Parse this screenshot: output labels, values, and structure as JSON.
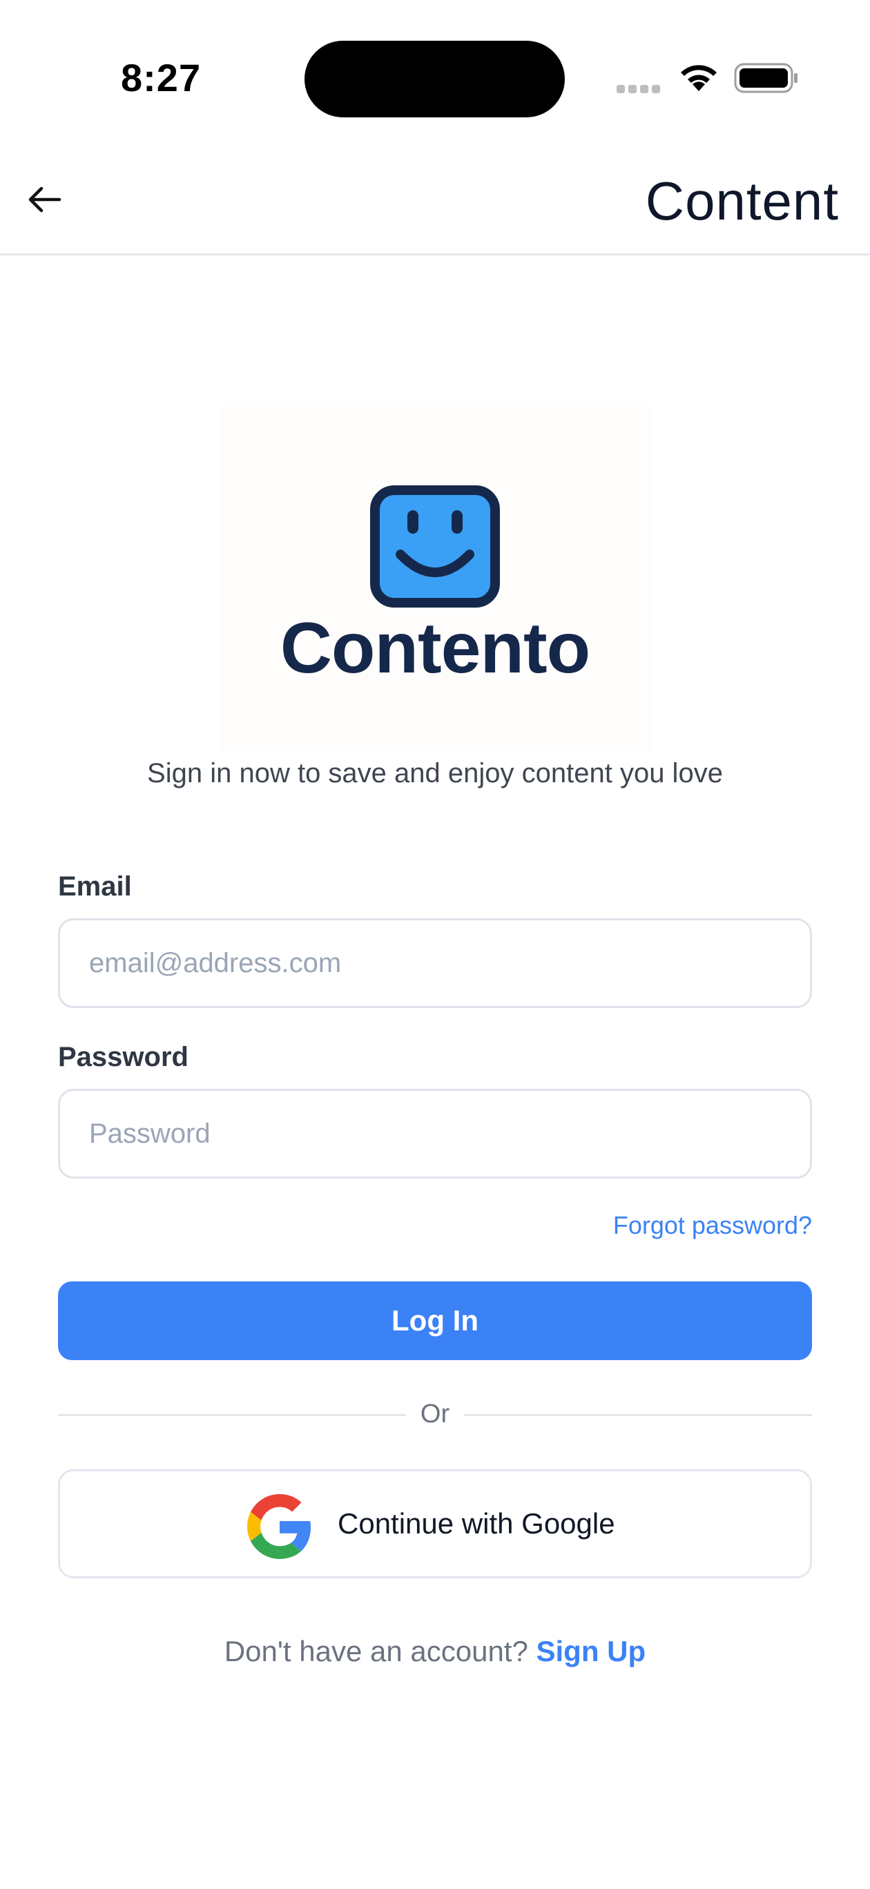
{
  "status_bar": {
    "time": "8:27"
  },
  "header": {
    "title": "Content",
    "back_icon": "arrow-left-icon"
  },
  "logo": {
    "icon": "smiley-face-icon",
    "text": "Contento",
    "colors": {
      "face_fill": "#3aa0f5",
      "face_outline": "#15284b",
      "text": "#15284b"
    }
  },
  "subtitle": "Sign in now to save and enjoy content you love",
  "form": {
    "email": {
      "label": "Email",
      "placeholder": "email@address.com",
      "value": ""
    },
    "password": {
      "label": "Password",
      "placeholder": "Password",
      "value": ""
    },
    "forgot_password": "Forgot password?",
    "login_button": "Log In",
    "divider": "Or",
    "google_button": "Continue with Google"
  },
  "signup": {
    "prompt": "Don't have an account?",
    "link": "Sign Up"
  },
  "colors": {
    "accent": "#3b82f6",
    "title_text": "#0f172a",
    "muted_text": "#6b7280"
  }
}
